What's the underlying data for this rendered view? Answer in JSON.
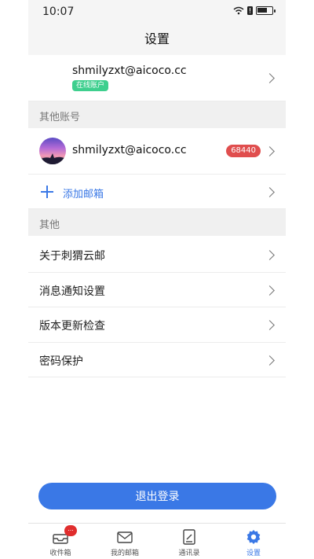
{
  "status_bar": {
    "time": "10:07"
  },
  "header": {
    "title": "设置"
  },
  "primary_account": {
    "email": "shmilyzxt@aicoco.cc",
    "badge": "在线账户"
  },
  "sections": {
    "other_accounts": "其他账号",
    "other": "其他"
  },
  "other_account": {
    "email": "shmilyzxt@aicoco.cc",
    "unread_count": "68440"
  },
  "add_mailbox": {
    "label": "添加邮箱"
  },
  "menu": {
    "items": [
      {
        "label": "关于刺猬云邮"
      },
      {
        "label": "消息通知设置"
      },
      {
        "label": "版本更新检查"
      },
      {
        "label": "密码保护"
      }
    ]
  },
  "logout": {
    "label": "退出登录"
  },
  "battery_level": 0.7,
  "tabbar": {
    "inbox_badge": "...",
    "items": [
      {
        "label": "收件箱",
        "icon": "inbox-icon"
      },
      {
        "label": "我的邮箱",
        "icon": "mailbox-icon"
      },
      {
        "label": "通讯录",
        "icon": "contacts-icon"
      },
      {
        "label": "设置",
        "icon": "settings-gear-icon"
      }
    ]
  },
  "colors": {
    "accent": "#3a78e6",
    "online": "#3ecf8e",
    "badge_red": "#e04e4e"
  }
}
